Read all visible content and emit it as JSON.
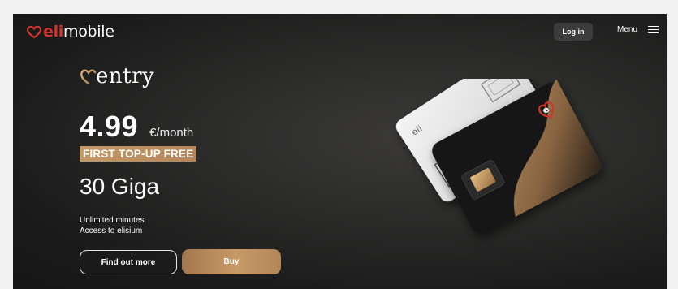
{
  "header": {
    "brand_left": "eli",
    "brand_right": "mobile",
    "login_label": "Log in",
    "menu_label": "Menu",
    "icons": {
      "menu": "hamburger-icon",
      "brand": "heart-logo-icon"
    }
  },
  "plan": {
    "name": "entry",
    "price": "4.99",
    "price_unit": "€/month",
    "promo": "FIRST TOP-UP FREE",
    "data_amount": "30 Giga",
    "features": [
      "Unlimited minutes",
      "Access to elisium"
    ]
  },
  "actions": {
    "find_out_more": "Find out more",
    "buy": "Buy"
  },
  "colors": {
    "accent_red": "#d0342c",
    "gold": "#c39a6a",
    "background": "#1e1e1e"
  }
}
